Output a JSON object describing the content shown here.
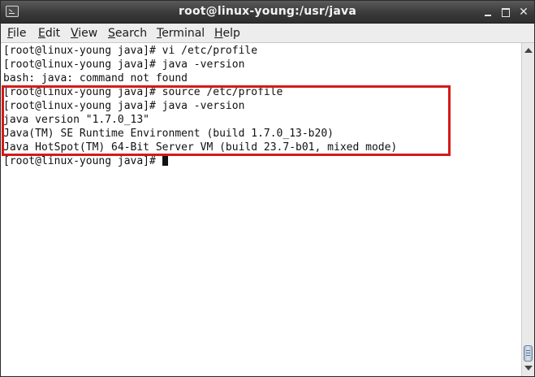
{
  "window": {
    "title": "root@linux-young:/usr/java"
  },
  "menu": {
    "items": [
      {
        "pre": "",
        "key": "F",
        "post": "ile"
      },
      {
        "pre": "",
        "key": "E",
        "post": "dit"
      },
      {
        "pre": "",
        "key": "V",
        "post": "iew"
      },
      {
        "pre": "",
        "key": "S",
        "post": "earch"
      },
      {
        "pre": "",
        "key": "T",
        "post": "erminal"
      },
      {
        "pre": "",
        "key": "H",
        "post": "elp"
      }
    ]
  },
  "terminal": {
    "lines": [
      "[root@linux-young java]# vi /etc/profile",
      "[root@linux-young java]# java -version",
      "bash: java: command not found",
      "[root@linux-young java]# source /etc/profile",
      "[root@linux-young java]# java -version",
      "java version \"1.7.0_13\"",
      "Java(TM) SE Runtime Environment (build 1.7.0_13-b20)",
      "Java HotSpot(TM) 64-Bit Server VM (build 23.7-b01, mixed mode)"
    ],
    "prompt": "[root@linux-young java]# "
  },
  "annotation": {
    "color": "#d41a1a"
  },
  "icons": {
    "app": "terminal-icon",
    "minimize": "minimize-icon",
    "maximize": "maximize-icon",
    "close": "close-icon",
    "scroll_up": "arrow-up-icon",
    "scroll_down": "arrow-down-icon"
  }
}
